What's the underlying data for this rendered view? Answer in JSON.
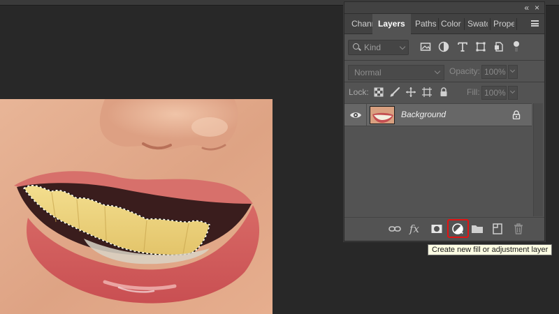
{
  "panel": {
    "collapse_glyph": "«",
    "close_glyph": "×",
    "tabs": [
      {
        "label": "Chann",
        "active": false
      },
      {
        "label": "Layers",
        "active": true
      },
      {
        "label": "Paths",
        "active": false
      },
      {
        "label": "Color",
        "active": false
      },
      {
        "label": "Swatc",
        "active": false
      },
      {
        "label": "Prope",
        "active": false
      }
    ],
    "filter": {
      "placeholder": "Kind",
      "icons": [
        "image-filter-icon",
        "adjustment-filter-icon",
        "type-filter-icon",
        "shape-filter-icon",
        "smart-object-filter-icon",
        "filter-toggle-icon"
      ]
    },
    "blend_mode": "Normal",
    "opacity_label": "Opacity:",
    "opacity_value": "100%",
    "lock_label": "Lock:",
    "fill_label": "Fill:",
    "fill_value": "100%",
    "layers": [
      {
        "name": "Background",
        "visible": true,
        "locked": true
      }
    ],
    "bottom_icons": [
      "link-layers-icon",
      "fx-icon",
      "add-mask-icon",
      "adjustment-layer-icon",
      "new-group-icon",
      "new-layer-icon",
      "delete-layer-icon"
    ],
    "fx_label": "fx"
  },
  "tooltip": {
    "text": "Create new fill or adjustment layer"
  },
  "colors": {
    "panel_bg": "#535353",
    "app_bg": "#282828",
    "highlight": "#e41212",
    "selected_layer": "#676767"
  }
}
